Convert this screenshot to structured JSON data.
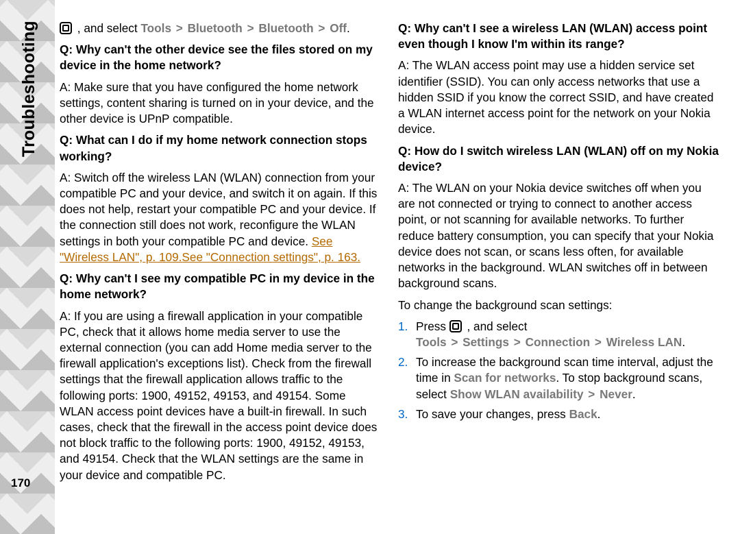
{
  "sidebar": {
    "label": "Troubleshooting",
    "page": "170"
  },
  "p1": {
    "t1": " , and select ",
    "m1": "Tools",
    "m2": "Bluetooth",
    "m3": "Bluetooth",
    "m4": "Off",
    "t2": "."
  },
  "q1": "Q: Why can't the other device see the files stored on my device in the home network?",
  "a1": "A: Make sure that you have configured the home network settings, content sharing is turned on in your device, and the other device is UPnP compatible.",
  "q2": "Q: What can I do if my home network connection stops working?",
  "a2a": "A: Switch off the wireless LAN (WLAN) connection from your compatible PC and your device, and switch it on again. If this does not help, restart your compatible PC and your device. If the connection still does not work, reconfigure the WLAN settings in both your compatible PC and device. ",
  "a2link1": "See \"Wireless LAN\", p. 109.",
  "a2link2": "See \"Connection settings\", p. 163.",
  "q3": "Q: Why can't I see my compatible PC in my device in the home network?",
  "a3": "A: If you are using a firewall application in your compatible PC, check that it allows home media server to use the external connection (you can add Home media server to the firewall application's exceptions list). Check from the firewall settings that the firewall application allows traffic to the following ports: 1900, 49152, 49153, and 49154. Some WLAN access point devices have a built-in firewall. In such cases, check that the firewall in the access point device does not block traffic to the following ports: 1900, 49152, 49153, and 49154. Check that the WLAN settings are the same in your device and compatible PC.",
  "q4": "Q: Why can't I see a wireless LAN (WLAN) access point even though I know I'm within its range?",
  "a4": "A: The WLAN access point may use a hidden service set identifier (SSID). You can only access networks that use a hidden SSID if you know the correct SSID, and have created a WLAN internet access point for the network on your Nokia device.",
  "q5": "Q: How do I switch wireless LAN (WLAN) off on my Nokia device?",
  "a5": "A: The WLAN on your Nokia device switches off when you are not connected or trying to connect to another access point, or not scanning for available networks. To further reduce battery consumption, you can specify that your Nokia device does not scan, or scans less often, for available networks in the background. WLAN switches off in between background scans.",
  "a5b": "To change the background scan settings:",
  "steps": {
    "s1": {
      "n": "1.",
      "a": "Press ",
      "b": " , and select ",
      "m1": "Tools",
      "m2": "Settings",
      "m3": "Connection",
      "m4": "Wireless LAN",
      "c": "."
    },
    "s2": {
      "n": "2.",
      "a": "To increase the background scan time interval, adjust the time in ",
      "m1": "Scan for networks",
      "b": ". To stop background scans, select ",
      "m2": "Show WLAN availability",
      "m3": "Never",
      "c": "."
    },
    "s3": {
      "n": "3.",
      "a": "To save your changes, press ",
      "m1": "Back",
      "b": "."
    }
  }
}
